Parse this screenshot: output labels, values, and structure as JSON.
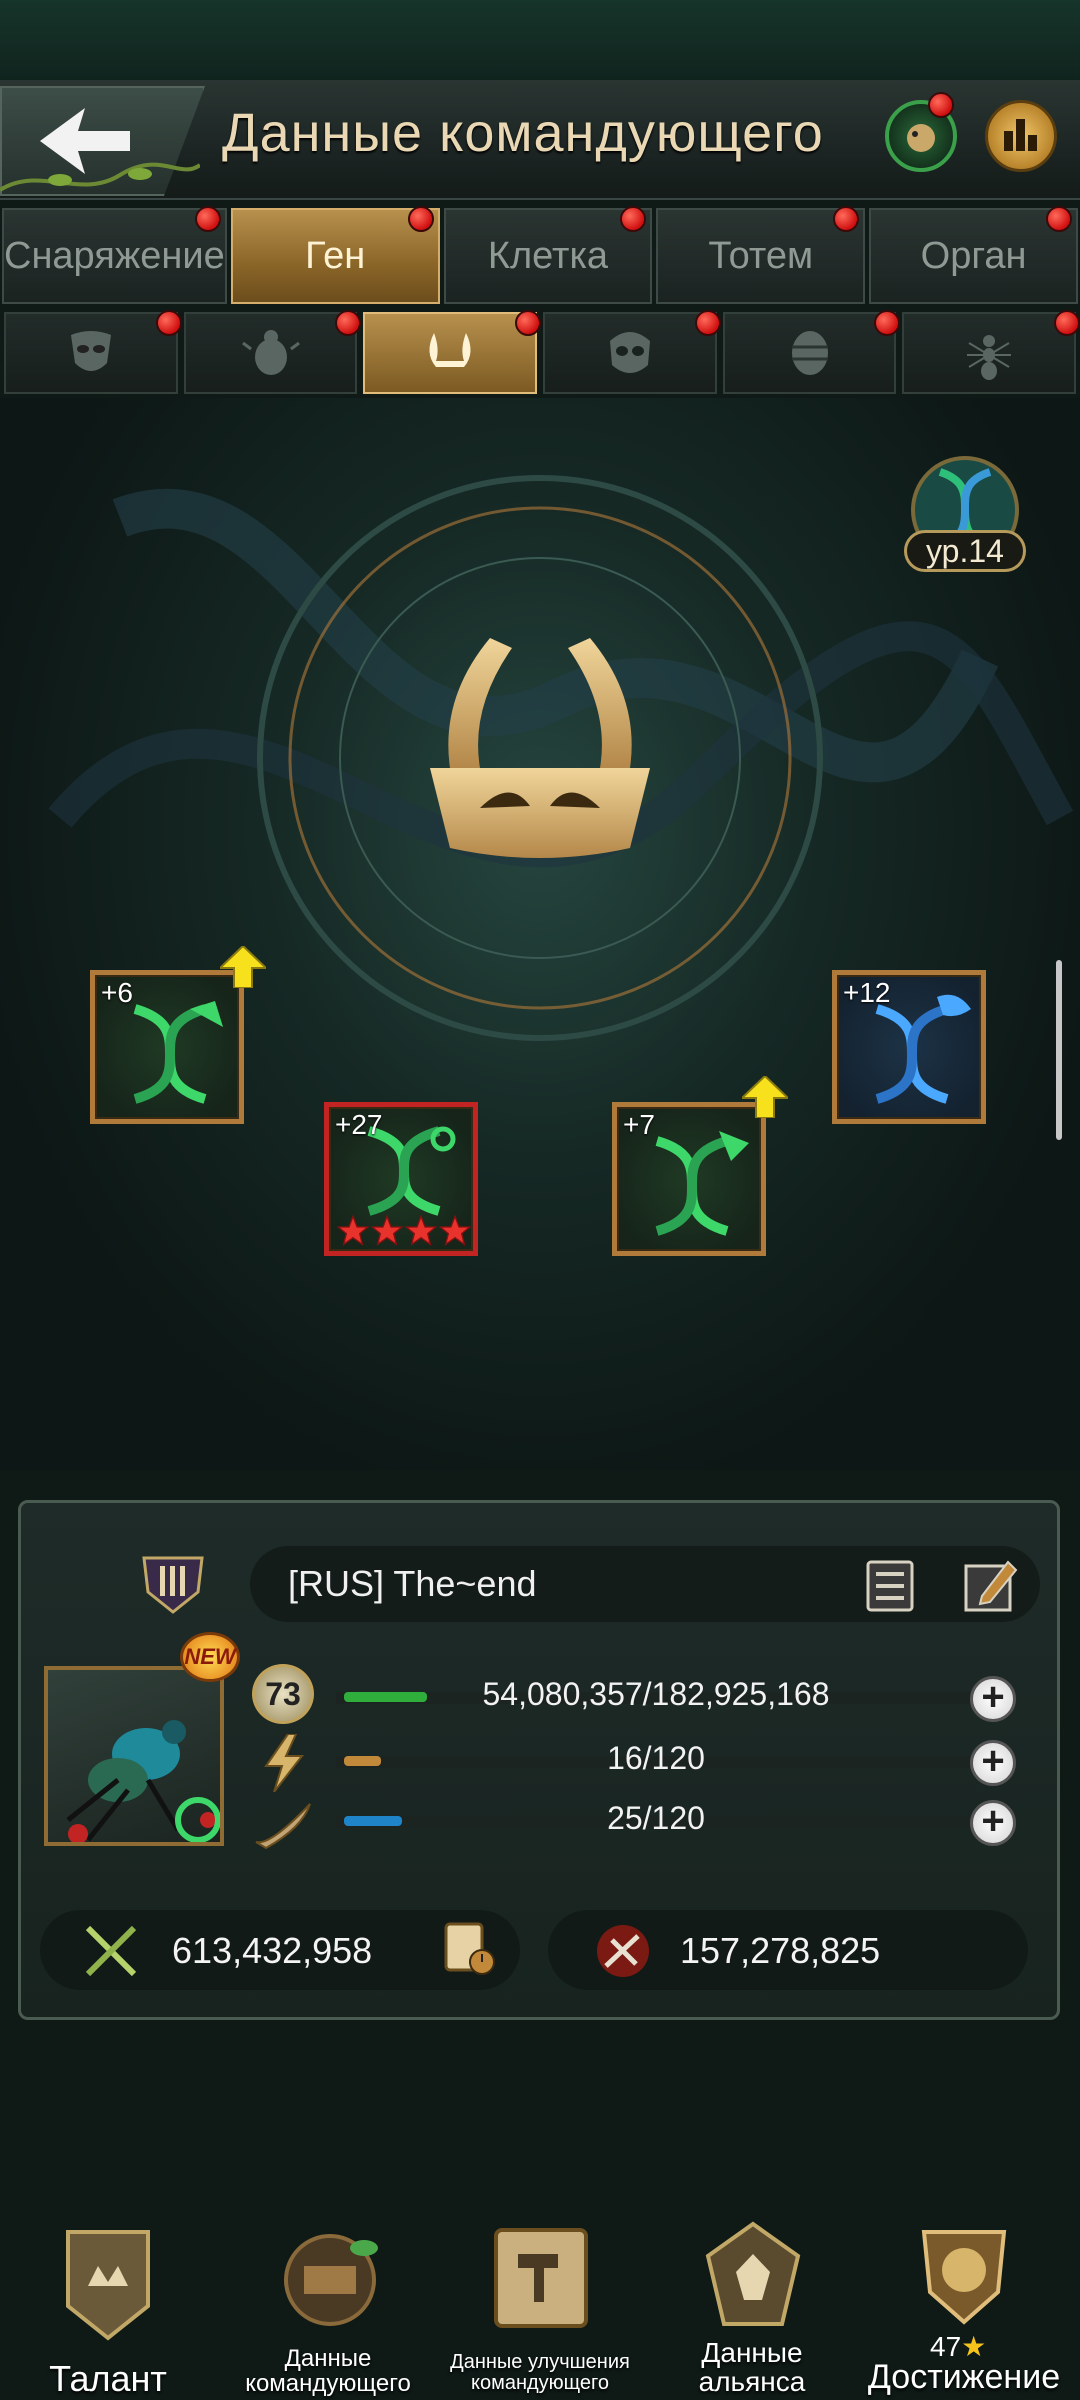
{
  "header": {
    "title": "Данные командующего"
  },
  "tabs": [
    {
      "label": "Снаряжение",
      "active": false,
      "has_alert": true
    },
    {
      "label": "Ген",
      "active": true,
      "has_alert": true
    },
    {
      "label": "Клетка",
      "active": false,
      "has_alert": true
    },
    {
      "label": "Тотем",
      "active": false,
      "has_alert": true
    },
    {
      "label": "Орган",
      "active": false,
      "has_alert": true
    }
  ],
  "subtabs": [
    {
      "icon": "insect-mask-icon",
      "active": false,
      "has_alert": true
    },
    {
      "icon": "beetle-icon",
      "active": false,
      "has_alert": true
    },
    {
      "icon": "mandible-icon",
      "active": true,
      "has_alert": true
    },
    {
      "icon": "skull-mask-icon",
      "active": false,
      "has_alert": true
    },
    {
      "icon": "cocoon-icon",
      "active": false,
      "has_alert": true
    },
    {
      "icon": "ant-icon",
      "active": false,
      "has_alert": true
    }
  ],
  "gene_level": {
    "label": "ур.14"
  },
  "gene_slots": [
    {
      "bonus": "+6",
      "color": "green",
      "upgradeable": true
    },
    {
      "bonus": "+27",
      "color": "green",
      "upgradeable": false,
      "stars": 4,
      "selected": true
    },
    {
      "bonus": "+7",
      "color": "green",
      "upgradeable": true
    },
    {
      "bonus": "+12",
      "color": "blue",
      "upgradeable": false
    }
  ],
  "commander": {
    "name": "[RUS]   The~end",
    "new_badge": "NEW",
    "level": "73",
    "exp": {
      "text": "54,080,357/182,925,168",
      "fraction": 0.296
    },
    "energy": {
      "text": "16/120",
      "fraction": 0.133
    },
    "stamina": {
      "text": "25/120",
      "fraction": 0.208
    },
    "power": "613,432,958",
    "kills": "157,278,825"
  },
  "nav": [
    {
      "label": "Талант",
      "icon": "talent-icon"
    },
    {
      "label": "Данные командующего",
      "icon": "commander-data-icon"
    },
    {
      "label": "Данные улучшения командующего",
      "icon": "upgrade-data-icon"
    },
    {
      "label": "Данные альянса",
      "icon": "alliance-data-icon"
    },
    {
      "label": "Достижение",
      "icon": "achievement-icon",
      "count": "47"
    }
  ],
  "colors": {
    "accent_gold": "#b7904d",
    "alert_red": "#d01010",
    "exp_green": "#2fae3b",
    "energy_orange": "#c2893a",
    "stamina_blue": "#1f84c8"
  }
}
